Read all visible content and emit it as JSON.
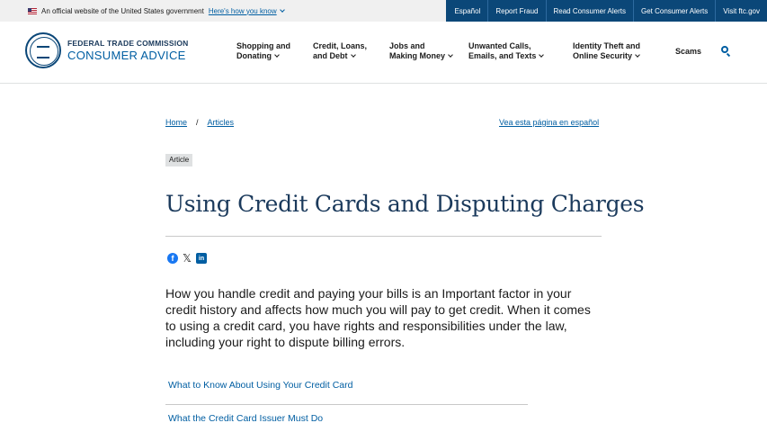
{
  "gov_banner": {
    "text": "An official website of the United States government",
    "link": "Here's how you know"
  },
  "utility_nav": [
    "Español",
    "Report Fraud",
    "Read Consumer Alerts",
    "Get Consumer Alerts",
    "Visit ftc.gov"
  ],
  "logo": {
    "line1": "FEDERAL TRADE COMMISSION",
    "line2": "CONSUMER ADVICE"
  },
  "main_nav": [
    {
      "line1": "Shopping and",
      "line2": "Donating"
    },
    {
      "line1": "Credit, Loans,",
      "line2": "and Debt"
    },
    {
      "line1": "Jobs and",
      "line2": "Making Money"
    },
    {
      "line1": "Unwanted Calls,",
      "line2": "Emails, and Texts"
    },
    {
      "line1": "Identity Theft and",
      "line2": "Online Security"
    }
  ],
  "nav_scams": "Scams",
  "breadcrumb": {
    "items": [
      "Home",
      "Articles"
    ],
    "separator": "/"
  },
  "lang_link": "Vea esta página en español",
  "tag": "Article",
  "title": "Using Credit Cards and Disputing Charges",
  "share_icons": {
    "facebook": "f",
    "x": "𝕏",
    "linkedin": "in"
  },
  "intro": "How you handle credit and paying your bills is an Important factor in your credit history and affects how much you will pay to get credit. When it comes to using a credit card, you have rights and responsibilities under the law, including your right to dispute billing errors.",
  "toc": [
    "What to Know About Using Your Credit Card",
    "What the Credit Card Issuer Must Do"
  ],
  "colors": {
    "link": "#005ea2",
    "utility_bar": "#0b4778",
    "title": "#1b3a5c"
  }
}
